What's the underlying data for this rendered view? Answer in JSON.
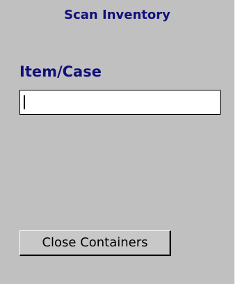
{
  "screen": {
    "title": "Scan Inventory",
    "item_label": "Item/Case",
    "item_input_value": "",
    "close_button_label": "Close Containers"
  },
  "colors": {
    "background": "#c0c0c0",
    "heading_text": "#10107a",
    "input_background": "#ffffff"
  }
}
